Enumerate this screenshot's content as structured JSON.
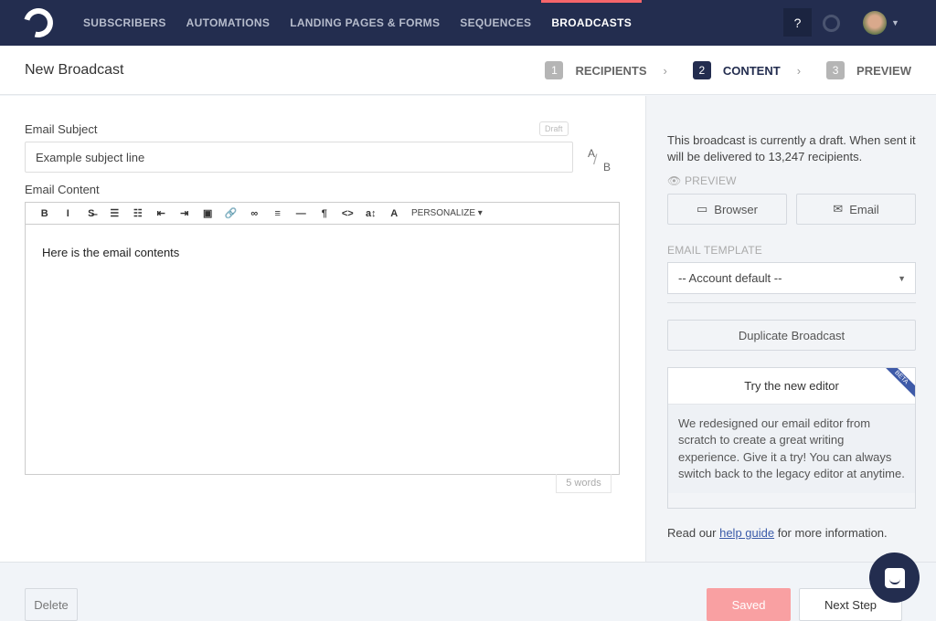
{
  "nav": {
    "items": [
      "SUBSCRIBERS",
      "AUTOMATIONS",
      "LANDING PAGES & FORMS",
      "SEQUENCES",
      "BROADCASTS"
    ],
    "active": "BROADCASTS",
    "help": "?"
  },
  "header": {
    "title": "New Broadcast",
    "steps": [
      {
        "num": "1",
        "label": "RECIPIENTS"
      },
      {
        "num": "2",
        "label": "CONTENT"
      },
      {
        "num": "3",
        "label": "PREVIEW"
      }
    ],
    "active_step": "CONTENT"
  },
  "form": {
    "subject_label": "Email Subject",
    "draft_badge": "Draft",
    "subject_value": "Example subject line",
    "ab_a": "A",
    "ab_b": "B",
    "content_label": "Email Content",
    "personalize": "PERSONALIZE ▾",
    "body": "Here is the email contents",
    "word_count": "5 words"
  },
  "toolbar": [
    "B",
    "I",
    "S̶",
    "☰",
    "☷",
    "⇤",
    "⇥",
    "▣",
    "🔗",
    "∞",
    "≡",
    "—",
    "¶",
    "<>",
    "a↕",
    "A"
  ],
  "sidebar": {
    "status": "This broadcast is currently a draft. When sent it will be delivered to 13,247 recipients.",
    "preview_label": "PREVIEW",
    "browser": "Browser",
    "email": "Email",
    "template_label": "EMAIL TEMPLATE",
    "template_value": "-- Account default --",
    "duplicate": "Duplicate Broadcast",
    "new_editor_title": "Try the new editor",
    "beta": "BETA",
    "new_editor_body": "We redesigned our email editor from scratch to create a great writing experience. Give it a try! You can always switch back to the legacy editor at anytime.",
    "read_pre": "Read our ",
    "help_link": "help guide",
    "read_post": " for more information."
  },
  "footer": {
    "delete": "Delete",
    "saved": "Saved",
    "next": "Next Step"
  },
  "colors": {
    "nav": "#232d4f",
    "accent": "#f5656a",
    "saved": "#f9a0a2",
    "link": "#3b5ba9"
  }
}
